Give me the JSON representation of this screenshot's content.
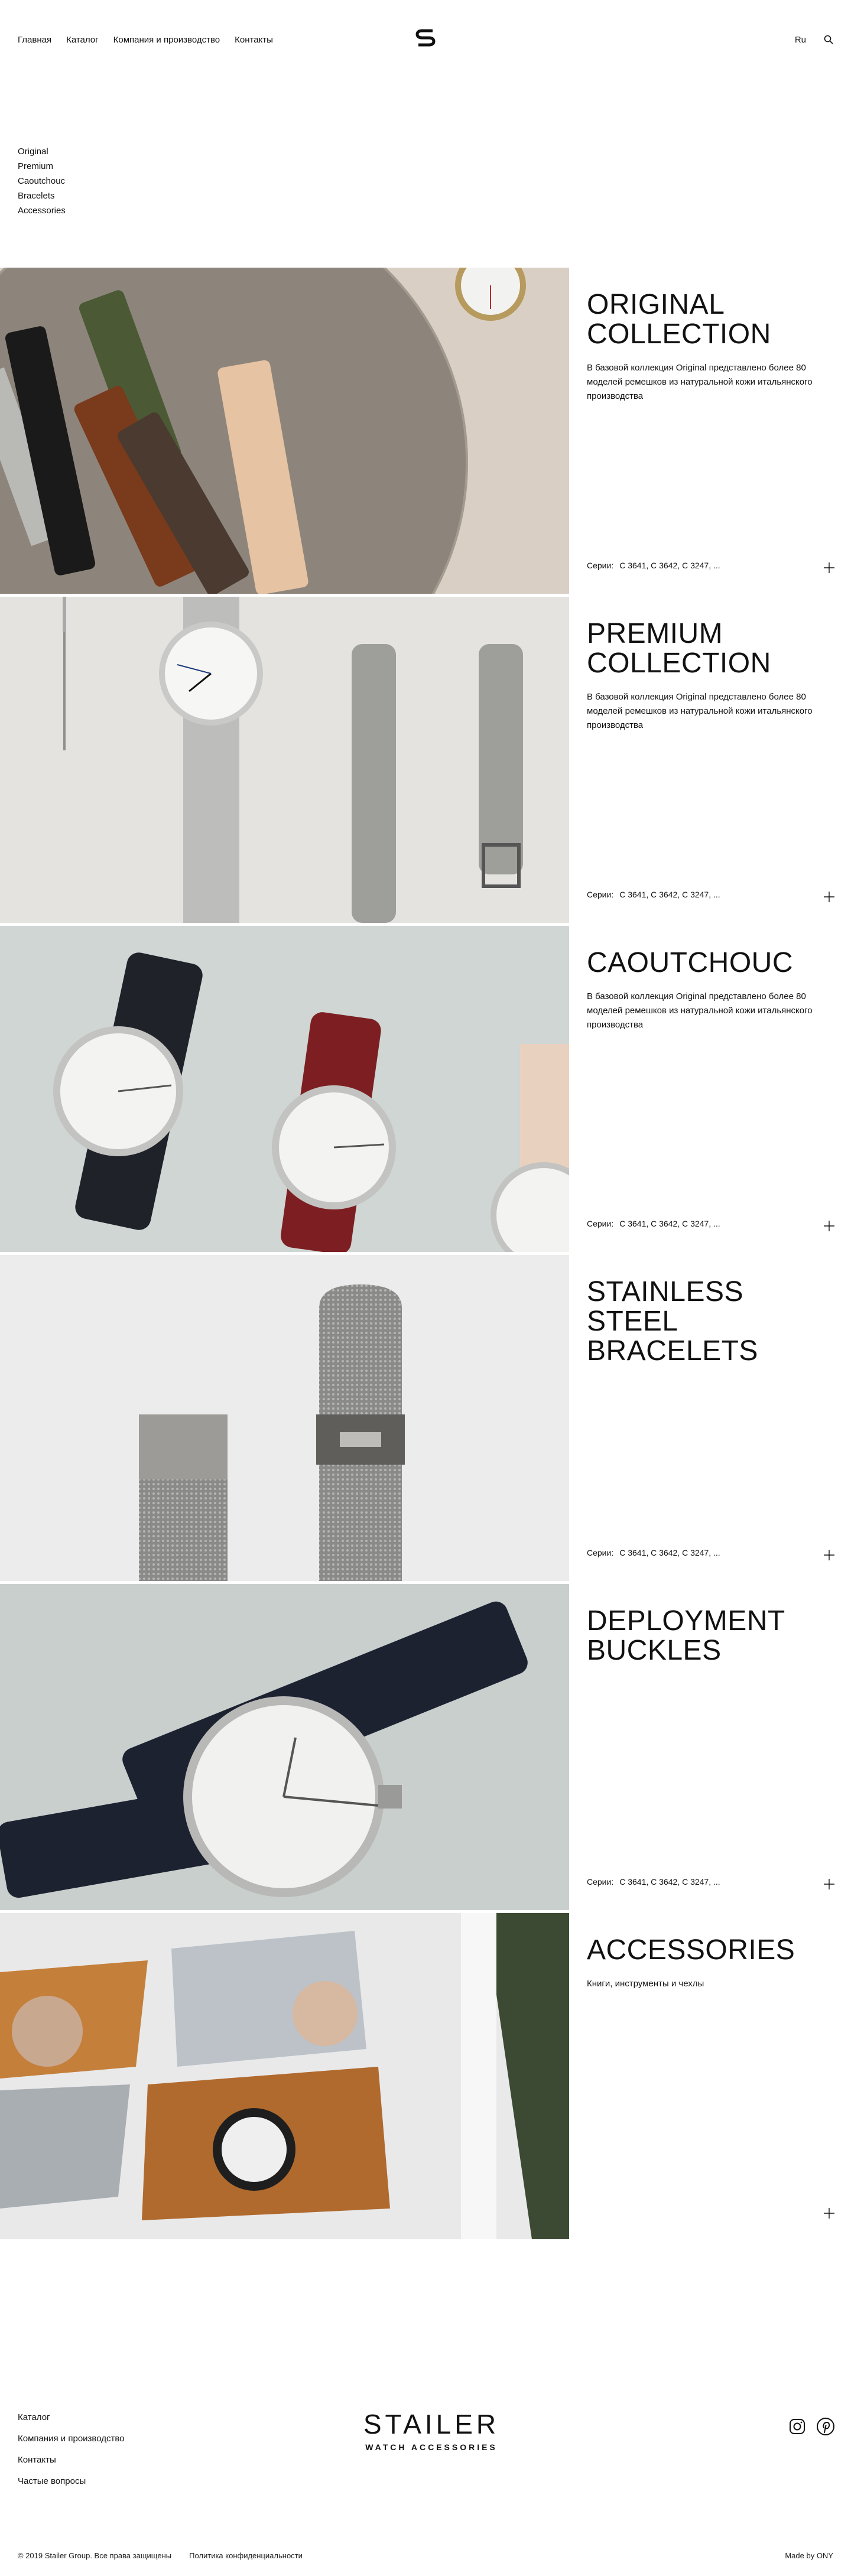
{
  "header": {
    "nav": [
      "Главная",
      "Каталог",
      "Компания и производство",
      "Контакты"
    ],
    "logo_icon": "stailer-s-logo-icon",
    "lang": "Ru",
    "search_icon": "search-icon"
  },
  "categories": [
    "Original",
    "Premium",
    "Caoutchouc",
    "Bracelets",
    "Accessories"
  ],
  "collections": [
    {
      "title": "Original collection",
      "description": "В базовой коллекция Original представлено более 80 моделей ремешков из натуральной кожи итальянского производства",
      "series_label": "Серии:",
      "series_value": "С 3641, С 3642, С 3247, ..."
    },
    {
      "title": "Premium collection",
      "description": "В базовой коллекция Original представлено более 80 моделей ремешков из натуральной кожи итальянского производства",
      "series_label": "Серии:",
      "series_value": "С 3641, С 3642, С 3247, ..."
    },
    {
      "title": "Caoutchouc",
      "description": "В базовой коллекция Original представлено более 80 моделей ремешков из натуральной кожи итальянского производства",
      "series_label": "Серии:",
      "series_value": "С 3641, С 3642, С 3247, ..."
    },
    {
      "title": "Stainless steel bracelets",
      "description": "",
      "series_label": "Серии:",
      "series_value": "С 3641, С 3642, С 3247, ..."
    },
    {
      "title": "Deployment buckles",
      "description": "",
      "series_label": "Серии:",
      "series_value": "С 3641, С 3642, С 3247, ..."
    },
    {
      "title": "Accessories",
      "description": "Книги, инструменты и чехлы",
      "series_label": "",
      "series_value": ""
    }
  ],
  "footer": {
    "links": [
      "Каталог",
      "Компания и производство",
      "Контакты",
      "Частые вопросы"
    ],
    "brand": "STAILER",
    "brand_sub": "WATCH ACCESSORIES",
    "socials": [
      "instagram-icon",
      "pinterest-icon"
    ],
    "copyright": "© 2019 Stailer Group. Все права защищены",
    "policy": "Политика конфиденциальности",
    "made_by": "Made by ONY"
  }
}
